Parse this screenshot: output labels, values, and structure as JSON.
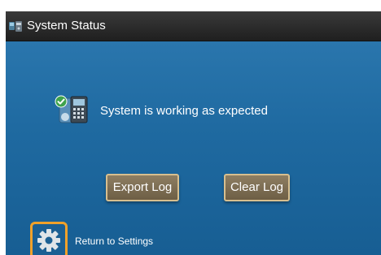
{
  "window": {
    "title": "System Status"
  },
  "status": {
    "message": "System is working as expected"
  },
  "actions": {
    "export_label": "Export Log",
    "clear_label": "Clear Log"
  },
  "footer": {
    "settings_label": "Return to Settings"
  },
  "colors": {
    "titlebar": "#2a2a2a",
    "panel": "#1f6aa1",
    "button": "#7d6e54",
    "button_border": "#d7bf8f",
    "settings_highlight": "#f0a12a"
  },
  "icons": {
    "title": "status-monitor-icon",
    "status": "device-ok-icon",
    "settings": "gear-icon"
  }
}
